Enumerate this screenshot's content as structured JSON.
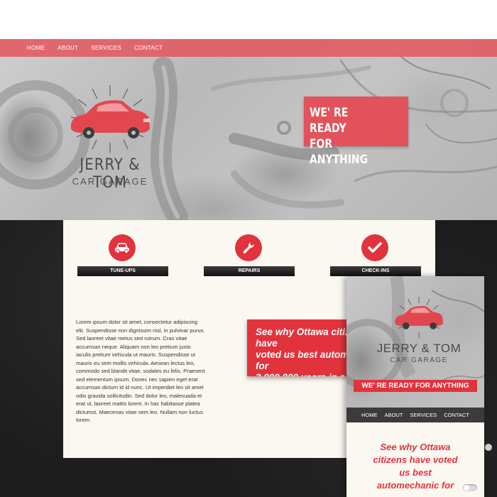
{
  "nav": {
    "items": [
      "HOME",
      "ABOUT",
      "SERVICES",
      "CONTACT"
    ]
  },
  "logo": {
    "title": "JERRY & TOM",
    "subtitle": "CAR GARAGE"
  },
  "hero": {
    "tagline": "WE' RE READY\nFOR ANYTHING"
  },
  "services": [
    {
      "label": "TUNE-UPS",
      "icon": "car-icon"
    },
    {
      "label": "REPAIRS",
      "icon": "wrench-icon"
    },
    {
      "label": "CHECK-INS",
      "icon": "checkmark-icon"
    }
  ],
  "body_text": "Lorem ipsum dolor sit amet, consectetur adipiscing elit. Suspendisse non dignissim nisl, in pulvinar purus. Sed laoreet vitae metus sed rutrum. Cras vitae accumsan neque. Aliquam non leo pretium justo iaculis pretium vehicula ut mauris. Suspendisse ut mauris eu sem mollis vehicula. Aenean lectus leo, commodo sed blandit vitae, sodales eu felis. Praesent sed elementum ipsum. Donec nec sapien eget erat accumsan dictum id id nunc. Ut imperdiet leo sit amet odio gravida sollicitudin. Sed dolor leo, malesuada et erat ut, laoreet mattis lorem. In hac habitasse platea dictumst. Maecenas vitae sem leo. Nullam non luctus lorem.",
  "quote": {
    "text": "See why Ottawa citizens have\nvoted us best automechanic for\n2,000,000 years in a row"
  },
  "mobile": {
    "logo_title": "JERRY & TOM",
    "logo_subtitle": "CAR GARAGE",
    "tagline": "WE' RE READY FOR ANYTHING",
    "nav": [
      "HOME",
      "ABOUT",
      "SERVICES",
      "CONTACT"
    ],
    "quote": "See why Ottawa\ncitizens have voted\nus best\nautomechanic for"
  },
  "colors": {
    "accent": "#e2333d",
    "nav_overlay": "#e25a60",
    "card": "#fbf8f1",
    "dark": "#1c1c1c"
  }
}
